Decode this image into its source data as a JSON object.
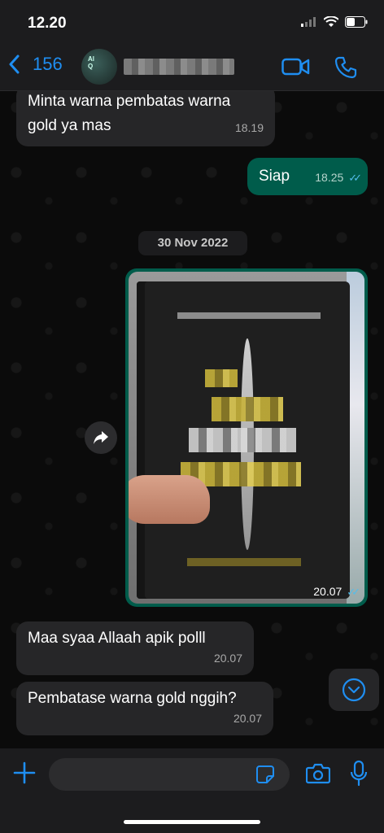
{
  "status": {
    "time": "12.20"
  },
  "header": {
    "back_count": "156",
    "avatar_text": "Al\nQ"
  },
  "messages": [
    {
      "direction": "in",
      "text": "Minta warna pembatas warna gold ya mas",
      "text_line1": "Minta warna pembatas warna",
      "text_line2": "gold ya mas",
      "time": "18.19"
    },
    {
      "direction": "out",
      "text": "Siap",
      "time": "18.25",
      "read": true
    },
    {
      "direction": "out",
      "type": "image",
      "time": "20.07",
      "read": true
    },
    {
      "direction": "in",
      "text": "Maa syaa Allaah apik polll",
      "time": "20.07"
    },
    {
      "direction": "in",
      "text": "Pembatase warna gold nggih?",
      "time": "20.07"
    }
  ],
  "date_separator": "30 Nov 2022",
  "input": {
    "placeholder": ""
  },
  "colors": {
    "accent": "#1f8ef1",
    "outgoing": "#005c4b",
    "incoming": "#262628",
    "read_tick": "#53bdeb"
  },
  "icons": [
    "back-chevron-icon",
    "video-call-icon",
    "phone-call-icon",
    "forward-icon",
    "chevron-down-icon",
    "plus-icon",
    "sticker-icon",
    "camera-icon",
    "microphone-icon",
    "read-receipt-icon"
  ]
}
